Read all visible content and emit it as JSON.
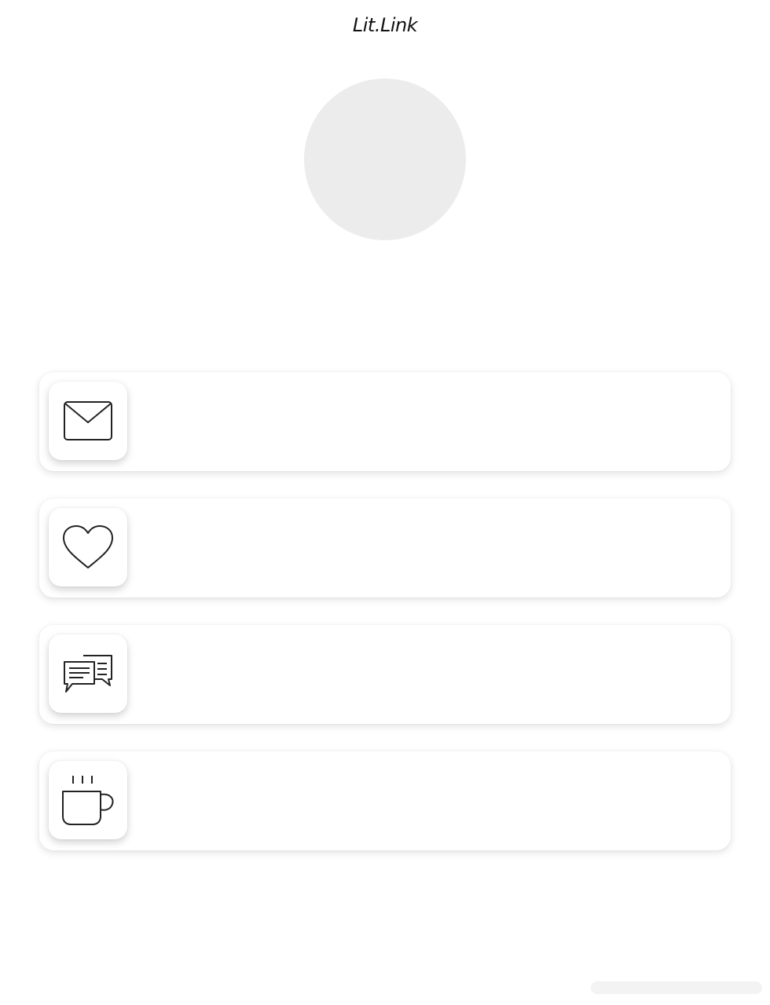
{
  "header": {
    "logo_text": "Lit.Link"
  },
  "profile": {
    "avatar_color": "#ececec"
  },
  "links": [
    {
      "icon": "mail-icon",
      "label": ""
    },
    {
      "icon": "heart-icon",
      "label": ""
    },
    {
      "icon": "chat-icon",
      "label": ""
    },
    {
      "icon": "coffee-cup-icon",
      "label": ""
    }
  ]
}
